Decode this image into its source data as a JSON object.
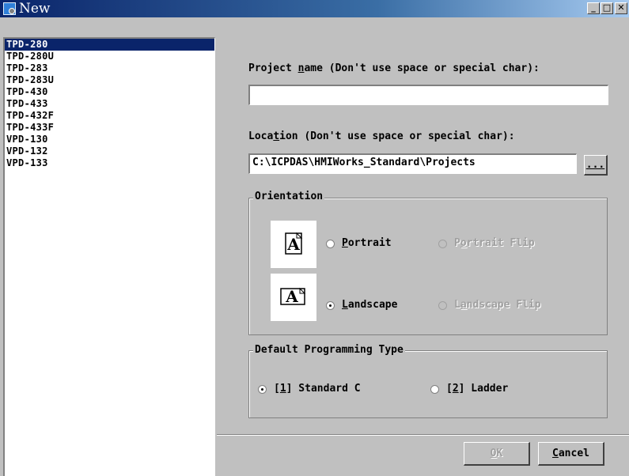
{
  "window": {
    "title": "New",
    "controls": {
      "minimize": "_",
      "maximize": "□",
      "close": "✕"
    }
  },
  "models": {
    "items": [
      "TPD-280",
      "TPD-280U",
      "TPD-283",
      "TPD-283U",
      "TPD-430",
      "TPD-433",
      "TPD-432F",
      "TPD-433F",
      "VPD-130",
      "VPD-132",
      "VPD-133"
    ],
    "selected": "TPD-280"
  },
  "project_name": {
    "label_pre": "Project ",
    "label_mn": "n",
    "label_post": "ame (Don't use space or special char):",
    "value": ""
  },
  "location": {
    "label_pre": "Loca",
    "label_mn": "t",
    "label_post": "ion (Don't use space or special char):",
    "value": "C:\\ICPDAS\\HMIWorks_Standard\\Projects",
    "browse_label": "..."
  },
  "orientation": {
    "title": "Orientation",
    "icon_letter": "A",
    "portrait": {
      "pre": "",
      "mn": "P",
      "post": "ortrait",
      "checked": false
    },
    "portrait_flip": {
      "pre": "P",
      "mn": "o",
      "post": "rtrait Flip",
      "enabled": false
    },
    "landscape": {
      "pre": "",
      "mn": "L",
      "post": "andscape",
      "checked": true
    },
    "landscape_flip": {
      "pre": "L",
      "mn": "a",
      "post": "ndscape Flip",
      "enabled": false
    }
  },
  "programming": {
    "title": "Default Programming Type",
    "standard_c": {
      "pre": "[",
      "mn": "1",
      "post": "] Standard C",
      "checked": true
    },
    "ladder": {
      "pre": "[",
      "mn": "2",
      "post": "] Ladder",
      "checked": false
    }
  },
  "buttons": {
    "ok": {
      "mn": "O",
      "post": "K",
      "enabled": false
    },
    "cancel": {
      "mn": "C",
      "post": "ancel"
    }
  }
}
